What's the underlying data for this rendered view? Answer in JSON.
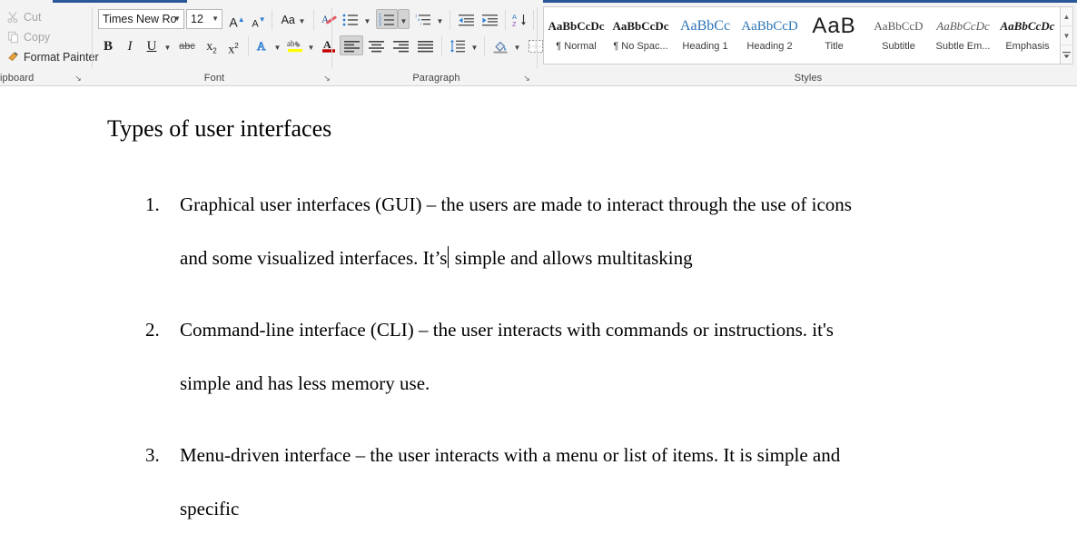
{
  "app": {
    "accent_color": "#2b579a",
    "ribbon_bg": "#f3f3f3"
  },
  "ribbon": {
    "groups": {
      "clipboard": {
        "label": "ipboard",
        "items": [
          {
            "icon": "scissors-icon",
            "label": "Cut",
            "enabled": false
          },
          {
            "icon": "copy-icon",
            "label": "Copy",
            "enabled": false
          },
          {
            "icon": "format-painter-icon",
            "label": "Format Painter",
            "enabled": true
          }
        ],
        "dialog_launcher": "↘"
      },
      "font": {
        "label": "Font",
        "font_name": "Times New Ro",
        "font_size": "12",
        "grow_font": "A",
        "shrink_font": "A",
        "change_case": "Aa",
        "clear_formatting": "clear-formatting-icon",
        "bold": "B",
        "italic": "I",
        "underline": "U",
        "strikethrough": "abc",
        "subscript": "x",
        "superscript": "x",
        "subscript_index": "2",
        "superscript_index": "2",
        "text_effects": "A",
        "highlight": "ab",
        "font_color": "A",
        "highlight_color": "#ffff00",
        "font_color_swatch": "#c00000",
        "dialog_launcher": "↘"
      },
      "paragraph": {
        "label": "Paragraph",
        "bullets": "bullets-icon",
        "numbering": "numbering-icon",
        "multilevel": "multilevel-list-icon",
        "decrease_indent": "decrease-indent-icon",
        "increase_indent": "increase-indent-icon",
        "sort": "sort-icon",
        "sort_letters": "AZ",
        "show_marks": "¶",
        "align_left": "align-left-icon",
        "align_center": "align-center-icon",
        "align_right": "align-right-icon",
        "justify": "justify-icon",
        "line_spacing": "line-spacing-icon",
        "shading": "shading-icon",
        "borders": "borders-icon",
        "dialog_launcher": "↘",
        "numbering_active": true,
        "align_left_active": true
      },
      "styles": {
        "label": "Styles",
        "gallery": [
          {
            "preview": "AaBbCcDc",
            "name": "¶ Normal",
            "class": "sp-normal"
          },
          {
            "preview": "AaBbCcDc",
            "name": "¶ No Spac...",
            "class": "sp-nospace"
          },
          {
            "preview": "AaBbCс",
            "name": "Heading 1",
            "class": "sp-h1"
          },
          {
            "preview": "AaBbCcD",
            "name": "Heading 2",
            "class": "sp-h2"
          },
          {
            "preview": "AaB",
            "name": "Title",
            "class": "sp-title"
          },
          {
            "preview": "AaBbCcD",
            "name": "Subtitle",
            "class": "sp-sub"
          },
          {
            "preview": "AaBbCcDc",
            "name": "Subtle Em...",
            "class": "sp-subem"
          },
          {
            "preview": "AaBbCcDc",
            "name": "Emphasis",
            "class": "sp-emph"
          }
        ],
        "scroll_up": "▲",
        "scroll_down": "▼",
        "more": "▼"
      }
    }
  },
  "document": {
    "heading": "Types of user interfaces",
    "list": [
      {
        "number": "1.",
        "line1": "Graphical user interfaces (GUI) – the users are made to interact through the use of icons",
        "line2_before_caret": "and some visualized interfaces. It’s",
        "has_caret": true,
        "line2_after_caret": " simple and allows multitasking"
      },
      {
        "number": "2.",
        "line1": "Command-line interface (CLI) – the user interacts with commands or instructions. it's",
        "line2_before_caret": "simple and has less memory use.",
        "has_caret": false,
        "line2_after_caret": ""
      },
      {
        "number": "3.",
        "line1": "Menu-driven interface – the user interacts with a menu or list of items. It is simple and",
        "line2_before_caret": "specific",
        "has_caret": false,
        "line2_after_caret": ""
      }
    ]
  }
}
